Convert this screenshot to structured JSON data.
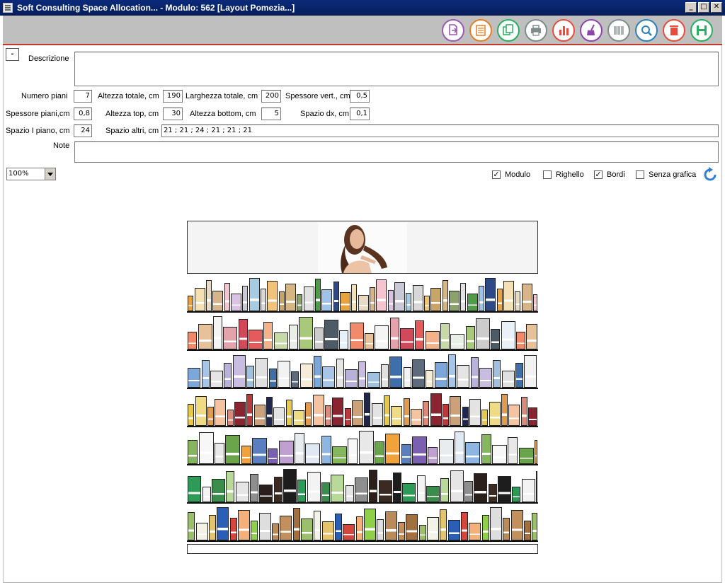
{
  "window": {
    "title": "Soft Consulting Space Allocation... - Modulo: 562 [Layout Pomezia...]",
    "controls": [
      "_",
      "□",
      "✕"
    ]
  },
  "toolbar": {
    "buttons": [
      {
        "name": "export-button",
        "icon": "export-icon",
        "color": "#9b59b6"
      },
      {
        "name": "list-button",
        "icon": "list-icon",
        "color": "#e67e22"
      },
      {
        "name": "copy-button",
        "icon": "copy-icon",
        "color": "#27ae60"
      },
      {
        "name": "print-button",
        "icon": "print-icon",
        "color": "#7f8c8d"
      },
      {
        "name": "chart-button",
        "icon": "bar-chart-icon",
        "color": "#e74c3c"
      },
      {
        "name": "clean-button",
        "icon": "broom-icon",
        "color": "#8e44ad"
      },
      {
        "name": "barcode-button",
        "icon": "barcode-icon",
        "color": "#7f8c8d"
      },
      {
        "name": "search-button",
        "icon": "search-icon",
        "color": "#2980b9"
      },
      {
        "name": "delete-button",
        "icon": "trash-icon",
        "color": "#e74c3c"
      },
      {
        "name": "save-button",
        "icon": "save-icon",
        "color": "#27ae60"
      }
    ]
  },
  "form": {
    "collapse_label": "-",
    "descrizione_label": "Descrizione",
    "descrizione_value": "",
    "numero_piani_label": "Numero piani",
    "numero_piani_value": "7",
    "altezza_totale_label": "Altezza totale, cm",
    "altezza_totale_value": "190",
    "larghezza_totale_label": "Larghezza totale, cm",
    "larghezza_totale_value": "200",
    "spessore_vert_label": "Spessore vert., cm",
    "spessore_vert_value": "0,5",
    "spessore_piani_label": "Spessore piani,cm",
    "spessore_piani_value": "0,8",
    "altezza_top_label": "Altezza top, cm",
    "altezza_top_value": "30",
    "altezza_bottom_label": "Altezza bottom, cm",
    "altezza_bottom_value": "5",
    "spazio_dx_label": "Spazio dx, cm",
    "spazio_dx_value": "0,1",
    "spazio_i_piano_label": "Spazio I piano, cm",
    "spazio_i_piano_value": "24",
    "spazio_altri_label": "Spazio altri, cm",
    "spazio_altri_value": "21 ; 21 ; 24 ; 21 ; 21 ; 21",
    "note_label": "Note",
    "note_value": ""
  },
  "view": {
    "zoom_value": "100%",
    "checkboxes": [
      {
        "label": "Modulo",
        "checked": true
      },
      {
        "label": "Righello",
        "checked": false
      },
      {
        "label": "Bordi",
        "checked": true
      },
      {
        "label": "Senza grafica",
        "checked": false
      }
    ]
  },
  "planogram": {
    "shelves": [
      {
        "palette": [
          "#e8a33c",
          "#f3e1b5",
          "#e8d9c4",
          "#d7b48a",
          "#f4c4cf",
          "#d9c2e3",
          "#c9c9d6",
          "#a7cbe3",
          "#d8d8d8",
          "#f0c27a",
          "#c9a467",
          "#d5b582",
          "#8ba36a",
          "#e2e2e2",
          "#4f9b4a",
          "#9fc3e8",
          "#2d4a86"
        ]
      },
      {
        "palette": [
          "#f08a6a",
          "#e7c19a",
          "#f4f4f4",
          "#e3a3ab",
          "#d04a5c",
          "#e55a5a",
          "#f3b28a",
          "#c7d9a7",
          "#e9eee6",
          "#a8c97a",
          "#cccccc",
          "#4d5b66",
          "#e8f1f7"
        ]
      },
      {
        "palette": [
          "#7da7d8",
          "#a9c5e6",
          "#e5e5e5",
          "#b9b1d7",
          "#c8bde0",
          "#9fc0de",
          "#e0e0e0",
          "#3f6fa8",
          "#f2f2f2",
          "#5d6b7c",
          "#f5edd7"
        ]
      },
      {
        "palette": [
          "#e6c84a",
          "#efdb84",
          "#e29a4d",
          "#f4c3a1",
          "#d98a7a",
          "#8a2430",
          "#b83a3a",
          "#caa17a",
          "#1f2750",
          "#e3e3e3"
        ]
      },
      {
        "palette": [
          "#86b760",
          "#f7f7f7",
          "#e8e8e8",
          "#6aa54b",
          "#f2a23b",
          "#5b7fbe",
          "#7b5fb0",
          "#c0a0d0",
          "#e9ecef",
          "#dfe8f3",
          "#8db7e2"
        ]
      },
      {
        "palette": [
          "#2e9a58",
          "#f3f3f3",
          "#3a8d4a",
          "#b9d99a",
          "#e5e5e5",
          "#8e8e8e",
          "#2a1f1a",
          "#3b2a22",
          "#1d1d1d"
        ]
      },
      {
        "palette": [
          "#9bbf6a",
          "#f2f2e6",
          "#e3c36b",
          "#2b5fb5",
          "#d5463c",
          "#f4b07a",
          "#8fcf4a",
          "#dedede",
          "#b98a5a",
          "#c28f5e",
          "#a2703f"
        ]
      }
    ]
  }
}
